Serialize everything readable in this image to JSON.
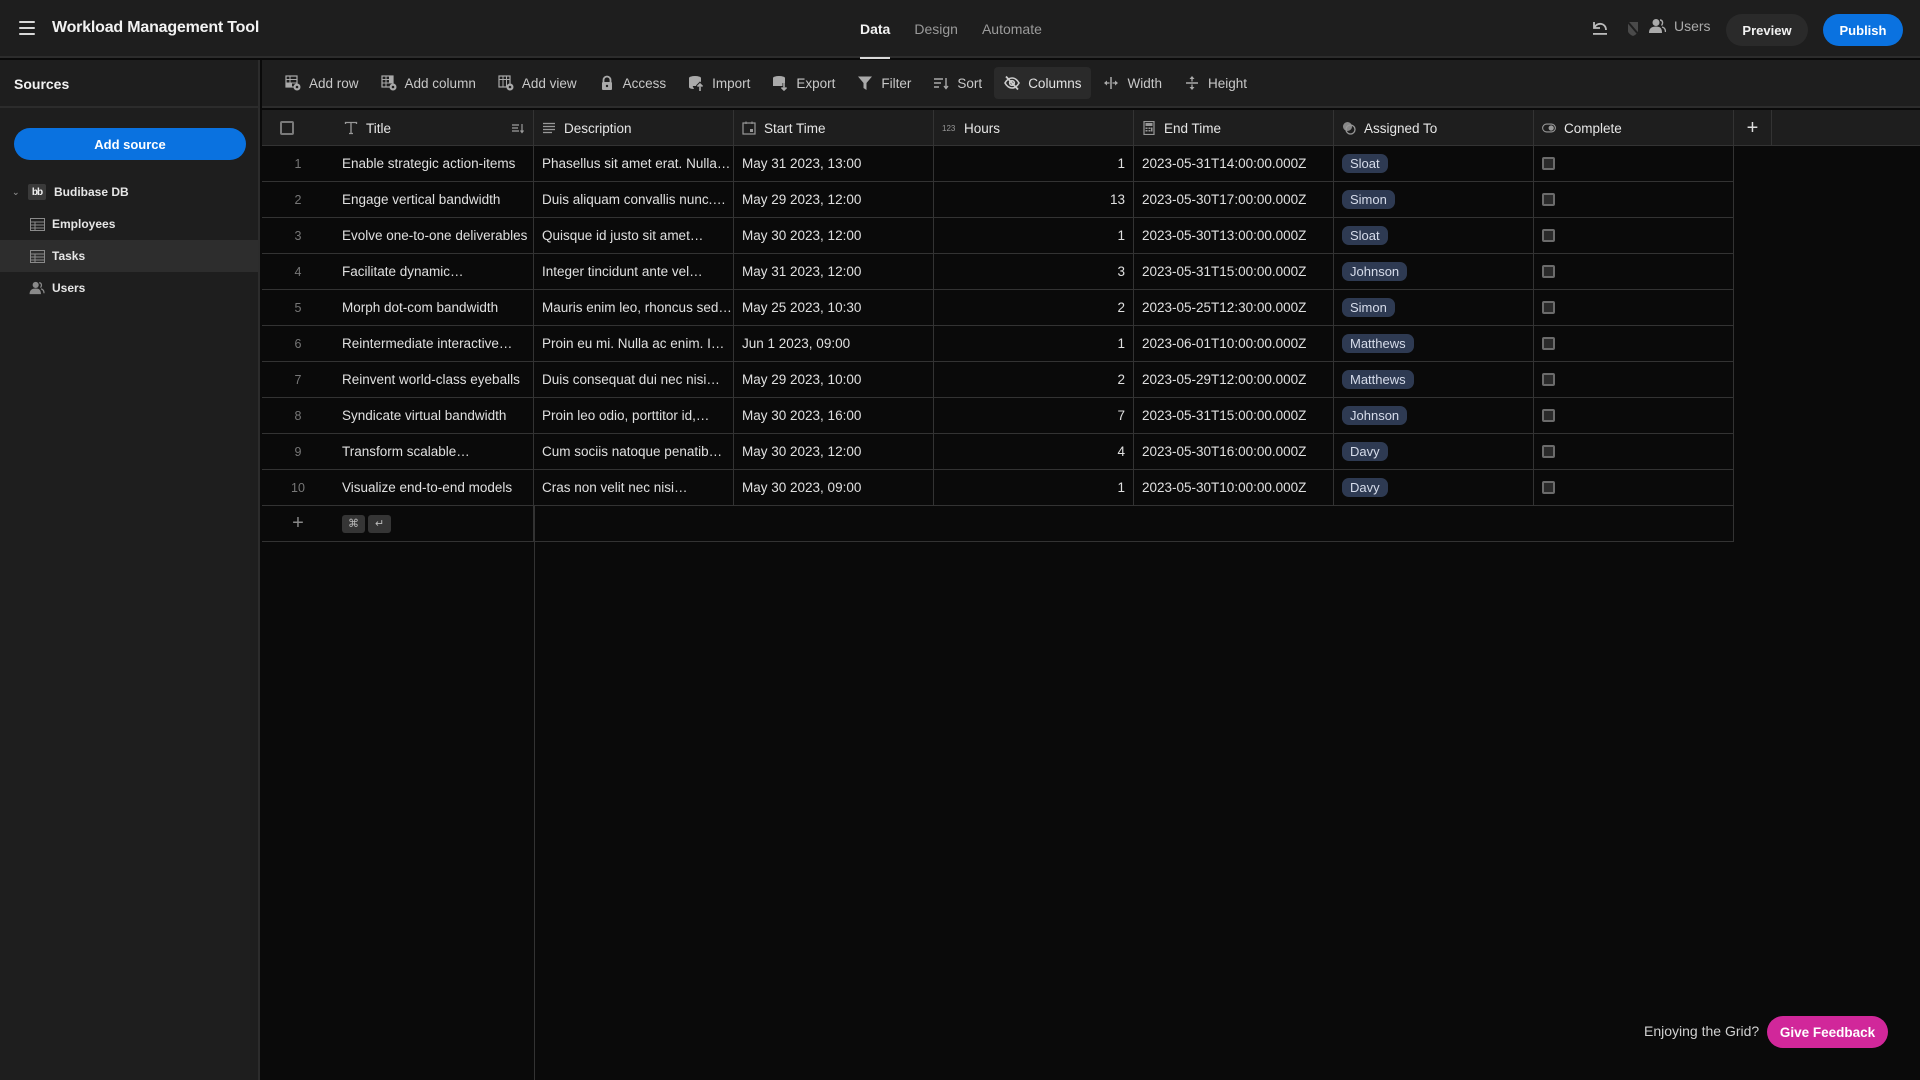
{
  "app": {
    "title": "Workload Management Tool",
    "tabs": [
      {
        "label": "Data",
        "active": true
      },
      {
        "label": "Design",
        "active": false
      },
      {
        "label": "Automate",
        "active": false
      }
    ],
    "users_label": "Users",
    "preview_label": "Preview",
    "publish_label": "Publish",
    "accent_color": "#0a72e0"
  },
  "sidebar": {
    "header": "Sources",
    "add_source_label": "Add source",
    "datasource": {
      "label": "Budibase DB",
      "logo": "bb"
    },
    "items": [
      {
        "label": "Employees",
        "icon": "table-icon",
        "selected": false
      },
      {
        "label": "Tasks",
        "icon": "table-icon",
        "selected": true
      },
      {
        "label": "Users",
        "icon": "users-icon",
        "selected": false
      }
    ]
  },
  "toolbar": {
    "buttons": [
      {
        "label": "Add row",
        "icon": "add-row-icon"
      },
      {
        "label": "Add column",
        "icon": "add-column-icon"
      },
      {
        "label": "Add view",
        "icon": "add-view-icon"
      },
      {
        "label": "Access",
        "icon": "lock-icon"
      },
      {
        "label": "Import",
        "icon": "import-icon"
      },
      {
        "label": "Export",
        "icon": "export-icon"
      },
      {
        "label": "Filter",
        "icon": "filter-icon"
      },
      {
        "label": "Sort",
        "icon": "sort-icon"
      },
      {
        "label": "Columns",
        "icon": "hide-columns-icon",
        "active": true
      },
      {
        "label": "Width",
        "icon": "width-icon"
      },
      {
        "label": "Height",
        "icon": "height-icon"
      }
    ]
  },
  "grid": {
    "columns": [
      {
        "label": "Title",
        "type": "text"
      },
      {
        "label": "Description",
        "type": "longform"
      },
      {
        "label": "Start Time",
        "type": "datetime"
      },
      {
        "label": "Hours",
        "type": "number"
      },
      {
        "label": "End Time",
        "type": "formula"
      },
      {
        "label": "Assigned To",
        "type": "relationship"
      },
      {
        "label": "Complete",
        "type": "boolean"
      }
    ],
    "rows": [
      {
        "n": "1",
        "title": "Enable strategic action-items",
        "description": "Phasellus sit amet erat. Nulla…",
        "start": "May 31 2023, 13:00",
        "hours": "1",
        "end": "2023-05-31T14:00:00.000Z",
        "assigned": "Sloat",
        "complete": false
      },
      {
        "n": "2",
        "title": "Engage vertical bandwidth",
        "description": "Duis aliquam convallis nunc.…",
        "start": "May 29 2023, 12:00",
        "hours": "13",
        "end": "2023-05-30T17:00:00.000Z",
        "assigned": "Simon",
        "complete": false
      },
      {
        "n": "3",
        "title": "Evolve one-to-one deliverables",
        "description": "Quisque id justo sit amet…",
        "start": "May 30 2023, 12:00",
        "hours": "1",
        "end": "2023-05-30T13:00:00.000Z",
        "assigned": "Sloat",
        "complete": false
      },
      {
        "n": "4",
        "title": "Facilitate dynamic…",
        "description": "Integer tincidunt ante vel…",
        "start": "May 31 2023, 12:00",
        "hours": "3",
        "end": "2023-05-31T15:00:00.000Z",
        "assigned": "Johnson",
        "complete": false
      },
      {
        "n": "5",
        "title": "Morph dot-com bandwidth",
        "description": "Mauris enim leo, rhoncus sed…",
        "start": "May 25 2023, 10:30",
        "hours": "2",
        "end": "2023-05-25T12:30:00.000Z",
        "assigned": "Simon",
        "complete": false
      },
      {
        "n": "6",
        "title": "Reintermediate interactive…",
        "description": "Proin eu mi. Nulla ac enim. I…",
        "start": "Jun 1 2023, 09:00",
        "hours": "1",
        "end": "2023-06-01T10:00:00.000Z",
        "assigned": "Matthews",
        "complete": false
      },
      {
        "n": "7",
        "title": "Reinvent world-class eyeballs",
        "description": "Duis consequat dui nec nisi…",
        "start": "May 29 2023, 10:00",
        "hours": "2",
        "end": "2023-05-29T12:00:00.000Z",
        "assigned": "Matthews",
        "complete": false
      },
      {
        "n": "8",
        "title": "Syndicate virtual bandwidth",
        "description": "Proin leo odio, porttitor id,…",
        "start": "May 30 2023, 16:00",
        "hours": "7",
        "end": "2023-05-31T15:00:00.000Z",
        "assigned": "Johnson",
        "complete": false
      },
      {
        "n": "9",
        "title": "Transform scalable…",
        "description": "Cum sociis natoque penatib…",
        "start": "May 30 2023, 12:00",
        "hours": "4",
        "end": "2023-05-30T16:00:00.000Z",
        "assigned": "Davy",
        "complete": false
      },
      {
        "n": "10",
        "title": "Visualize end-to-end models",
        "description": "Cras non velit nec nisi…",
        "start": "May 30 2023, 09:00",
        "hours": "1",
        "end": "2023-05-30T10:00:00.000Z",
        "assigned": "Davy",
        "complete": false
      }
    ],
    "new_row_shortcut": [
      "⌘",
      "↵"
    ]
  },
  "feedback": {
    "prompt": "Enjoying the Grid?",
    "button_label": "Give Feedback",
    "button_color": "#d1279a"
  }
}
